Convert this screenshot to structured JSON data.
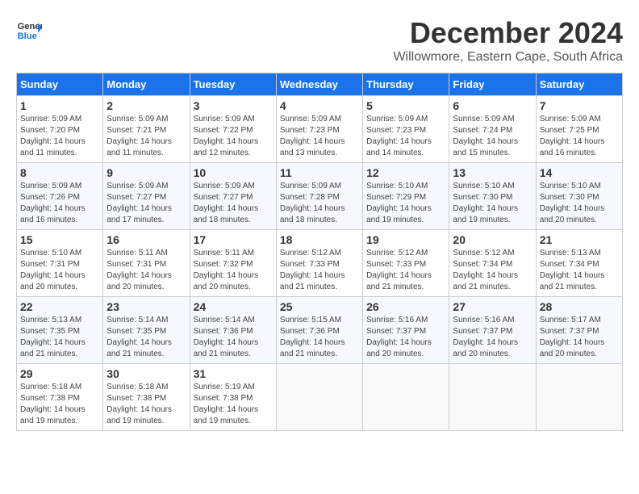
{
  "header": {
    "logo_general": "General",
    "logo_blue": "Blue",
    "month_title": "December 2024",
    "location": "Willowmore, Eastern Cape, South Africa"
  },
  "days_of_week": [
    "Sunday",
    "Monday",
    "Tuesday",
    "Wednesday",
    "Thursday",
    "Friday",
    "Saturday"
  ],
  "weeks": [
    [
      {
        "day": "1",
        "sunrise": "5:09 AM",
        "sunset": "7:20 PM",
        "daylight": "14 hours and 11 minutes."
      },
      {
        "day": "2",
        "sunrise": "5:09 AM",
        "sunset": "7:21 PM",
        "daylight": "14 hours and 11 minutes."
      },
      {
        "day": "3",
        "sunrise": "5:09 AM",
        "sunset": "7:22 PM",
        "daylight": "14 hours and 12 minutes."
      },
      {
        "day": "4",
        "sunrise": "5:09 AM",
        "sunset": "7:23 PM",
        "daylight": "14 hours and 13 minutes."
      },
      {
        "day": "5",
        "sunrise": "5:09 AM",
        "sunset": "7:23 PM",
        "daylight": "14 hours and 14 minutes."
      },
      {
        "day": "6",
        "sunrise": "5:09 AM",
        "sunset": "7:24 PM",
        "daylight": "14 hours and 15 minutes."
      },
      {
        "day": "7",
        "sunrise": "5:09 AM",
        "sunset": "7:25 PM",
        "daylight": "14 hours and 16 minutes."
      }
    ],
    [
      {
        "day": "8",
        "sunrise": "5:09 AM",
        "sunset": "7:26 PM",
        "daylight": "14 hours and 16 minutes."
      },
      {
        "day": "9",
        "sunrise": "5:09 AM",
        "sunset": "7:27 PM",
        "daylight": "14 hours and 17 minutes."
      },
      {
        "day": "10",
        "sunrise": "5:09 AM",
        "sunset": "7:27 PM",
        "daylight": "14 hours and 18 minutes."
      },
      {
        "day": "11",
        "sunrise": "5:09 AM",
        "sunset": "7:28 PM",
        "daylight": "14 hours and 18 minutes."
      },
      {
        "day": "12",
        "sunrise": "5:10 AM",
        "sunset": "7:29 PM",
        "daylight": "14 hours and 19 minutes."
      },
      {
        "day": "13",
        "sunrise": "5:10 AM",
        "sunset": "7:30 PM",
        "daylight": "14 hours and 19 minutes."
      },
      {
        "day": "14",
        "sunrise": "5:10 AM",
        "sunset": "7:30 PM",
        "daylight": "14 hours and 20 minutes."
      }
    ],
    [
      {
        "day": "15",
        "sunrise": "5:10 AM",
        "sunset": "7:31 PM",
        "daylight": "14 hours and 20 minutes."
      },
      {
        "day": "16",
        "sunrise": "5:11 AM",
        "sunset": "7:31 PM",
        "daylight": "14 hours and 20 minutes."
      },
      {
        "day": "17",
        "sunrise": "5:11 AM",
        "sunset": "7:32 PM",
        "daylight": "14 hours and 20 minutes."
      },
      {
        "day": "18",
        "sunrise": "5:12 AM",
        "sunset": "7:33 PM",
        "daylight": "14 hours and 21 minutes."
      },
      {
        "day": "19",
        "sunrise": "5:12 AM",
        "sunset": "7:33 PM",
        "daylight": "14 hours and 21 minutes."
      },
      {
        "day": "20",
        "sunrise": "5:12 AM",
        "sunset": "7:34 PM",
        "daylight": "14 hours and 21 minutes."
      },
      {
        "day": "21",
        "sunrise": "5:13 AM",
        "sunset": "7:34 PM",
        "daylight": "14 hours and 21 minutes."
      }
    ],
    [
      {
        "day": "22",
        "sunrise": "5:13 AM",
        "sunset": "7:35 PM",
        "daylight": "14 hours and 21 minutes."
      },
      {
        "day": "23",
        "sunrise": "5:14 AM",
        "sunset": "7:35 PM",
        "daylight": "14 hours and 21 minutes."
      },
      {
        "day": "24",
        "sunrise": "5:14 AM",
        "sunset": "7:36 PM",
        "daylight": "14 hours and 21 minutes."
      },
      {
        "day": "25",
        "sunrise": "5:15 AM",
        "sunset": "7:36 PM",
        "daylight": "14 hours and 21 minutes."
      },
      {
        "day": "26",
        "sunrise": "5:16 AM",
        "sunset": "7:37 PM",
        "daylight": "14 hours and 20 minutes."
      },
      {
        "day": "27",
        "sunrise": "5:16 AM",
        "sunset": "7:37 PM",
        "daylight": "14 hours and 20 minutes."
      },
      {
        "day": "28",
        "sunrise": "5:17 AM",
        "sunset": "7:37 PM",
        "daylight": "14 hours and 20 minutes."
      }
    ],
    [
      {
        "day": "29",
        "sunrise": "5:18 AM",
        "sunset": "7:38 PM",
        "daylight": "14 hours and 19 minutes."
      },
      {
        "day": "30",
        "sunrise": "5:18 AM",
        "sunset": "7:38 PM",
        "daylight": "14 hours and 19 minutes."
      },
      {
        "day": "31",
        "sunrise": "5:19 AM",
        "sunset": "7:38 PM",
        "daylight": "14 hours and 19 minutes."
      },
      null,
      null,
      null,
      null
    ]
  ],
  "labels": {
    "sunrise": "Sunrise:",
    "sunset": "Sunset:",
    "daylight": "Daylight:"
  }
}
